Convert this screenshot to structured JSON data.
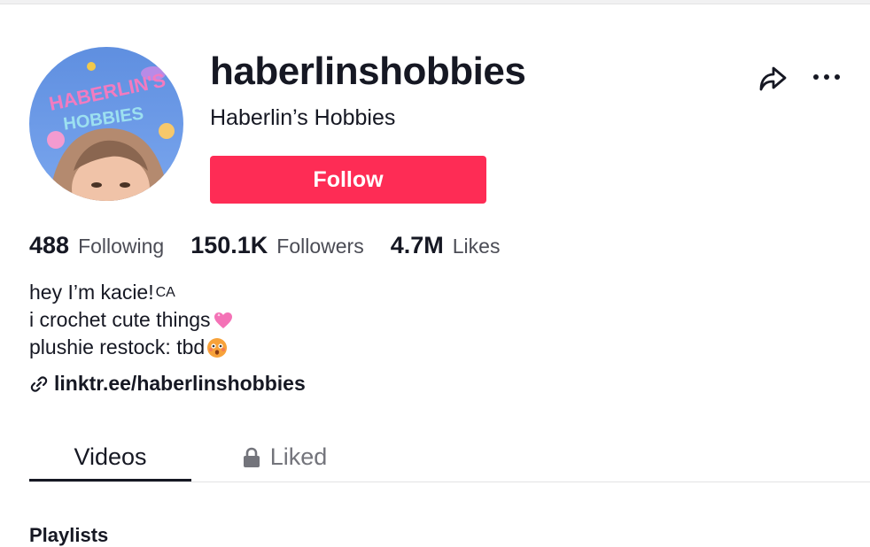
{
  "profile": {
    "username": "haberlinshobbies",
    "nickname": "Haberlin’s Hobbies",
    "avatar_text_top": "HABERLIN'S",
    "avatar_text_bottom": "HOBBIES",
    "follow_label": "Follow",
    "share_icon": "share-arrow-icon",
    "more_icon": "ellipsis-icon"
  },
  "stats": {
    "following": {
      "count": "488",
      "label": "Following"
    },
    "followers": {
      "count": "150.1K",
      "label": "Followers"
    },
    "likes": {
      "count": "4.7M",
      "label": "Likes"
    }
  },
  "bio": {
    "line1": "hey I’m kacie!",
    "line1_suffix": "CA",
    "line2": "i crochet cute things",
    "line2_emoji": "pink-heart-icon",
    "line3": "plushie restock: tbd",
    "line3_emoji": "flushed-face-icon"
  },
  "link": {
    "text": "linktr.ee/haberlinshobbies",
    "icon": "link-icon"
  },
  "tabs": [
    {
      "label": "Videos",
      "active": true
    },
    {
      "label": "Liked",
      "active": false,
      "locked": true
    }
  ],
  "section": {
    "playlists": "Playlists"
  },
  "colors": {
    "follow": "#fe2c55",
    "text": "#161823",
    "secondary": "#73747b"
  }
}
